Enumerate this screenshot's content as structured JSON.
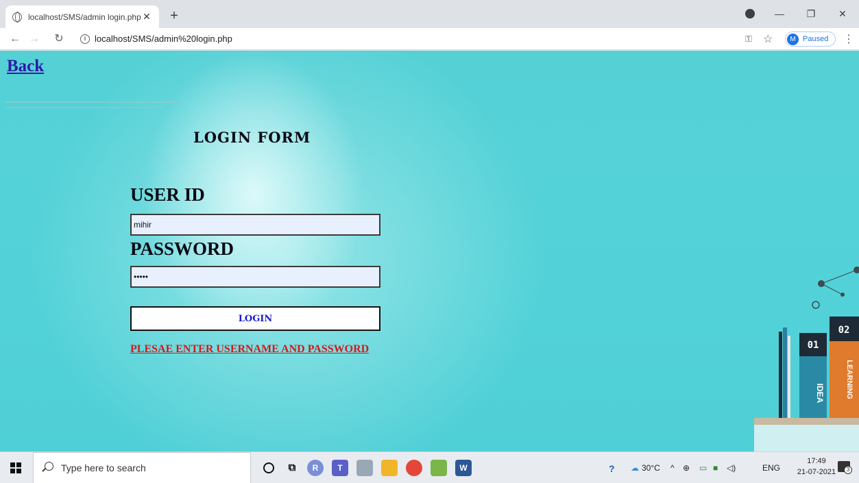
{
  "browser": {
    "tab_title": "localhost/SMS/admin login.php",
    "tab_close": "✕",
    "new_tab": "+",
    "url": "localhost/SMS/admin%20login.php",
    "profile_initial": "M",
    "profile_status": "Paused",
    "window_controls": [
      "—",
      "❐",
      "✕"
    ]
  },
  "page": {
    "back_link": "Back",
    "form_title": "LOGIN FORM",
    "user_label": "USER ID",
    "user_value": "mihir",
    "password_label": "PASSWORD",
    "password_value": "•••••",
    "login_button": "LOGIN",
    "error_message": "PLESAE ENTER USERNAME AND PASSWORD"
  },
  "decoration": {
    "book_labels": [
      "01",
      "02",
      "IDEA",
      "LEARNING"
    ]
  },
  "taskbar": {
    "search_placeholder": "Type here to search",
    "weather": "30°C",
    "language": "ENG",
    "time": "17:49",
    "date": "21-07-2021",
    "notification_count": "3"
  },
  "colors": {
    "page_background": "#52d2d8",
    "back_link": "#2d1aa8",
    "login_text": "#1a1ad0",
    "error_text": "#d21a1a",
    "field_background": "#e8f0fe"
  }
}
